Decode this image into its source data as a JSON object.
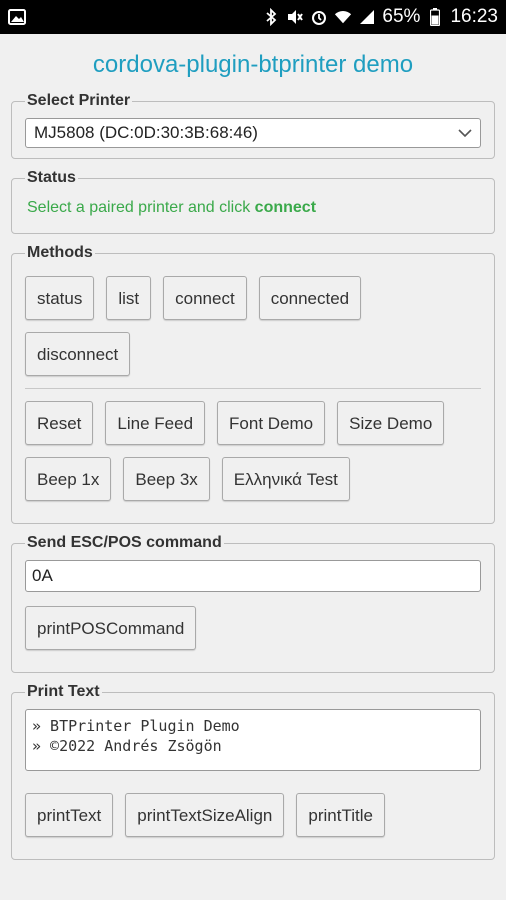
{
  "statusbar": {
    "battery": "65%",
    "time": "16:23"
  },
  "app": {
    "title": "cordova-plugin-btprinter demo"
  },
  "select_printer": {
    "legend": "Select Printer",
    "selected": "MJ5808 (DC:0D:30:3B:68:46)"
  },
  "status": {
    "legend": "Status",
    "message_prefix": "Select a paired printer and click ",
    "message_bold": "connect"
  },
  "methods": {
    "legend": "Methods",
    "row1": [
      "status",
      "list",
      "connect",
      "connected"
    ],
    "row2": [
      "disconnect"
    ],
    "row3": [
      "Reset",
      "Line Feed",
      "Font Demo",
      "Size Demo"
    ],
    "row4": [
      "Beep 1x",
      "Beep 3x",
      "Ελληνικά Test"
    ]
  },
  "escpos": {
    "legend": "Send ESC/POS command",
    "value": "0A",
    "button": "printPOSCommand"
  },
  "print_text": {
    "legend": "Print Text",
    "line1": "» BTPrinter Plugin Demo",
    "line2": "» ©2022 Andrés Zsögön",
    "buttons": [
      "printText",
      "printTextSizeAlign",
      "printTitle"
    ]
  },
  "colors": {
    "title": "#1f9ec0",
    "status_text": "#3aa94a",
    "statusbar_bg": "#000000"
  }
}
